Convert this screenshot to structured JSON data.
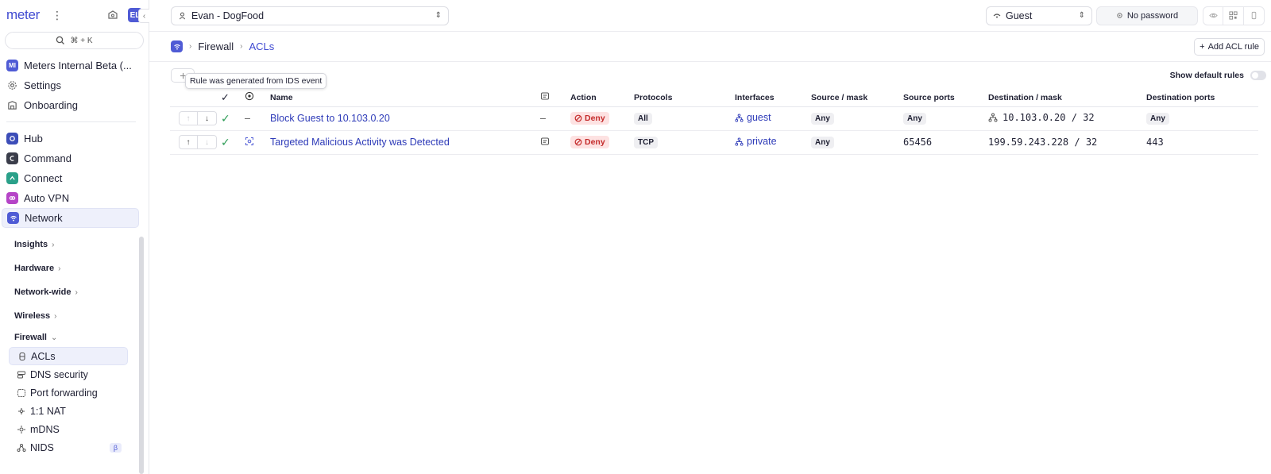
{
  "sidebar": {
    "logo": "meter",
    "avatar_initials": "EL",
    "search_shortcut": "⌘ + K",
    "top_items": [
      {
        "label": "Meters Internal Beta (...",
        "badge": "MI"
      },
      {
        "label": "Settings"
      },
      {
        "label": "Onboarding"
      }
    ],
    "product_items": [
      {
        "label": "Hub"
      },
      {
        "label": "Command"
      },
      {
        "label": "Connect"
      },
      {
        "label": "Auto VPN"
      },
      {
        "label": "Network"
      }
    ],
    "sections": [
      {
        "label": "Insights"
      },
      {
        "label": "Hardware"
      },
      {
        "label": "Network-wide"
      },
      {
        "label": "Wireless"
      },
      {
        "label": "Firewall"
      }
    ],
    "firewall_items": [
      {
        "label": "ACLs"
      },
      {
        "label": "DNS security"
      },
      {
        "label": "Port forwarding"
      },
      {
        "label": "1:1 NAT"
      },
      {
        "label": "mDNS"
      },
      {
        "label": "NIDS",
        "badge": "β"
      }
    ]
  },
  "topbar": {
    "network_select": "Evan - DogFood",
    "ssid_select": "Guest",
    "password_label": "No password"
  },
  "breadcrumb": {
    "parent": "Firewall",
    "current": "ACLs"
  },
  "actions": {
    "add_acl": "Add ACL rule",
    "show_default_rules": "Show default rules"
  },
  "tooltip": "Rule was generated from IDS event",
  "table": {
    "columns": {
      "name": "Name",
      "action": "Action",
      "protocols": "Protocols",
      "interfaces": "Interfaces",
      "source_mask": "Source / mask",
      "source_ports": "Source ports",
      "destination_mask": "Destination / mask",
      "destination_ports": "Destination ports"
    },
    "rows": [
      {
        "ids": "–",
        "name": "Block Guest to 10.103.0.20",
        "desc": "–",
        "action": "Deny",
        "protocols": "All",
        "interface": "guest",
        "source_mask": "Any",
        "source_ports": "Any",
        "destination_mask": "10.103.0.20 / 32",
        "destination_ports": "Any"
      },
      {
        "ids": "",
        "name": "Targeted Malicious Activity was Detected",
        "desc": "",
        "action": "Deny",
        "protocols": "TCP",
        "interface": "private",
        "source_mask": "Any",
        "source_ports": "65456",
        "destination_mask": "199.59.243.228 / 32",
        "destination_ports": "443"
      }
    ]
  },
  "colors": {
    "brand": "#3f4ad1",
    "deny_bg": "#fde2e2",
    "deny_text": "#c42b2b",
    "enabled_check": "#2c9c55"
  }
}
